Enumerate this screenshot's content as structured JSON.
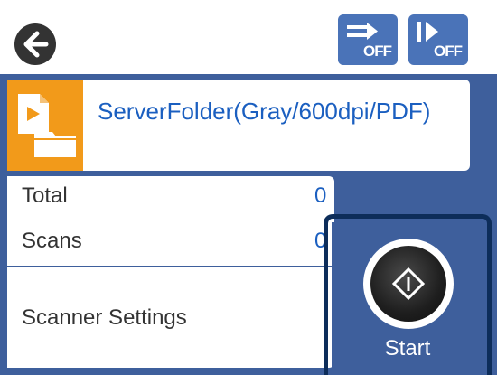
{
  "toolbar": {
    "back_icon": "arrow-left-icon",
    "buttons": [
      {
        "icon": "double-feed-detection-off-icon",
        "state": "OFF"
      },
      {
        "icon": "skip-blank-page-off-icon",
        "state": "OFF"
      }
    ]
  },
  "preset": {
    "icon": "scan-to-folder-icon",
    "title": "ServerFolder(Gray/600dpi/PDF)"
  },
  "counts": {
    "total_label": "Total",
    "total_value": "0",
    "scans_label": "Scans",
    "scans_value": "0"
  },
  "settings": {
    "label": "Scanner Settings"
  },
  "start": {
    "label": "Start",
    "icon": "start-diamond-icon"
  },
  "colors": {
    "accent_blue": "#3e5f9c",
    "button_blue": "#4a73b8",
    "text_blue": "#1b5fc0",
    "folder_orange": "#f29a1a",
    "highlight_outline": "#0d2d5a"
  }
}
